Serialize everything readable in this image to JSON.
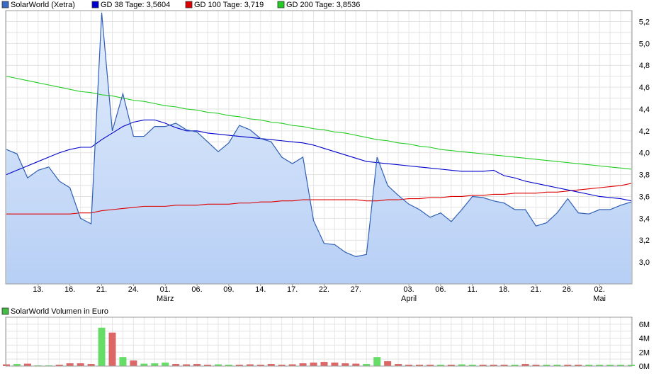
{
  "legend": [
    {
      "label": "SolarWorld (Xetra)",
      "color": "#3a6bc4"
    },
    {
      "label": "GD 38 Tage: 3,5604",
      "color": "#0000cc"
    },
    {
      "label": "GD 100 Tage: 3,719",
      "color": "#dd0000"
    },
    {
      "label": "GD 200 Tage: 3,8536",
      "color": "#22cc22"
    }
  ],
  "volume_legend": {
    "label": "SolarWorld Volumen in Euro",
    "color": "#44bb44"
  },
  "colors": {
    "price_line": "#2f5fb5",
    "price_fill_top": "#e4eefc",
    "price_fill_bottom": "#b7cff5",
    "gd38": "#0000cc",
    "gd100": "#dd0000",
    "gd200": "#22cc22",
    "volume_up": "#66dd66",
    "volume_down": "#dd6666",
    "grid": "#dddddd",
    "border": "#999999"
  },
  "chart_data": [
    {
      "type": "line",
      "title": "",
      "x_index_range": [
        0,
        59
      ],
      "ylim": [
        2.8,
        5.3
      ],
      "y_ticks": [
        {
          "v": 3.0,
          "label": "3,0"
        },
        {
          "v": 3.2,
          "label": "3,2"
        },
        {
          "v": 3.4,
          "label": "3,4"
        },
        {
          "v": 3.6,
          "label": "3,6"
        },
        {
          "v": 3.8,
          "label": "3,8"
        },
        {
          "v": 4.0,
          "label": "4,0"
        },
        {
          "v": 4.2,
          "label": "4,2"
        },
        {
          "v": 4.4,
          "label": "4,4"
        },
        {
          "v": 4.6,
          "label": "4,6"
        },
        {
          "v": 4.8,
          "label": "4,8"
        },
        {
          "v": 5.0,
          "label": "5,0"
        },
        {
          "v": 5.2,
          "label": "5,2"
        }
      ],
      "x_ticks": [
        {
          "i": 3,
          "label": "13."
        },
        {
          "i": 6,
          "label": "16."
        },
        {
          "i": 9,
          "label": "21."
        },
        {
          "i": 12,
          "label": "24."
        },
        {
          "i": 15,
          "label": "01.",
          "month": "März"
        },
        {
          "i": 18,
          "label": "06."
        },
        {
          "i": 21,
          "label": "09."
        },
        {
          "i": 24,
          "label": "14."
        },
        {
          "i": 27,
          "label": "17."
        },
        {
          "i": 30,
          "label": "22."
        },
        {
          "i": 33,
          "label": "27."
        },
        {
          "i": 38,
          "label": "03.",
          "month": "April"
        },
        {
          "i": 41,
          "label": "06."
        },
        {
          "i": 44,
          "label": "11."
        },
        {
          "i": 47,
          "label": "18."
        },
        {
          "i": 50,
          "label": "21."
        },
        {
          "i": 53,
          "label": "26."
        },
        {
          "i": 56,
          "label": "02.",
          "month": "Mai"
        }
      ],
      "series": [
        {
          "name": "SolarWorld (Xetra)",
          "values": [
            4.03,
            3.99,
            3.77,
            3.84,
            3.87,
            3.74,
            3.68,
            3.4,
            3.35,
            5.28,
            4.2,
            4.54,
            4.15,
            4.15,
            4.24,
            4.24,
            4.27,
            4.21,
            4.19,
            4.1,
            4.01,
            4.09,
            4.25,
            4.21,
            4.13,
            4.1,
            3.96,
            3.9,
            3.96,
            3.38,
            3.17,
            3.16,
            3.09,
            3.05,
            3.07,
            3.96,
            3.7,
            3.61,
            3.53,
            3.48,
            3.41,
            3.45,
            3.37,
            3.48,
            3.6,
            3.59,
            3.56,
            3.54,
            3.48,
            3.48,
            3.33,
            3.36,
            3.45,
            3.58,
            3.45,
            3.44,
            3.48,
            3.48,
            3.52,
            3.55
          ]
        },
        {
          "name": "GD 38 Tage: 3,5604",
          "values": [
            3.8,
            3.84,
            3.88,
            3.92,
            3.96,
            4.0,
            4.03,
            4.05,
            4.05,
            4.12,
            4.18,
            4.24,
            4.28,
            4.3,
            4.3,
            4.27,
            4.23,
            4.2,
            4.2,
            4.18,
            4.17,
            4.16,
            4.15,
            4.14,
            4.13,
            4.12,
            4.11,
            4.1,
            4.09,
            4.07,
            4.04,
            4.01,
            3.98,
            3.95,
            3.92,
            3.91,
            3.9,
            3.89,
            3.88,
            3.87,
            3.86,
            3.85,
            3.84,
            3.83,
            3.83,
            3.83,
            3.84,
            3.79,
            3.77,
            3.74,
            3.72,
            3.7,
            3.68,
            3.66,
            3.64,
            3.62,
            3.6,
            3.59,
            3.58,
            3.56
          ]
        },
        {
          "name": "GD 100 Tage: 3,719",
          "values": [
            3.44,
            3.44,
            3.44,
            3.44,
            3.44,
            3.44,
            3.44,
            3.45,
            3.45,
            3.47,
            3.48,
            3.49,
            3.5,
            3.51,
            3.51,
            3.51,
            3.52,
            3.52,
            3.52,
            3.53,
            3.53,
            3.53,
            3.54,
            3.54,
            3.55,
            3.55,
            3.56,
            3.56,
            3.57,
            3.57,
            3.57,
            3.57,
            3.57,
            3.57,
            3.56,
            3.56,
            3.57,
            3.57,
            3.58,
            3.58,
            3.59,
            3.59,
            3.6,
            3.6,
            3.61,
            3.61,
            3.62,
            3.62,
            3.63,
            3.63,
            3.63,
            3.64,
            3.64,
            3.65,
            3.66,
            3.67,
            3.68,
            3.69,
            3.7,
            3.72
          ]
        },
        {
          "name": "GD 200 Tage: 3,8536",
          "values": [
            4.7,
            4.68,
            4.66,
            4.64,
            4.62,
            4.6,
            4.58,
            4.56,
            4.55,
            4.53,
            4.52,
            4.5,
            4.48,
            4.47,
            4.45,
            4.43,
            4.42,
            4.4,
            4.39,
            4.37,
            4.36,
            4.34,
            4.33,
            4.31,
            4.3,
            4.28,
            4.27,
            4.25,
            4.24,
            4.22,
            4.21,
            4.19,
            4.18,
            4.16,
            4.14,
            4.12,
            4.11,
            4.09,
            4.08,
            4.06,
            4.05,
            4.03,
            4.02,
            4.01,
            4.0,
            3.99,
            3.98,
            3.97,
            3.96,
            3.95,
            3.94,
            3.93,
            3.92,
            3.91,
            3.9,
            3.89,
            3.88,
            3.87,
            3.86,
            3.85
          ]
        }
      ]
    },
    {
      "type": "bar",
      "title": "SolarWorld Volumen in Euro",
      "unit": "M",
      "ylim": [
        0,
        7
      ],
      "y_ticks": [
        {
          "v": 0,
          "label": "0M"
        },
        {
          "v": 2,
          "label": "2M"
        },
        {
          "v": 4,
          "label": "4M"
        },
        {
          "v": 6,
          "label": "6M"
        }
      ],
      "series": [
        {
          "name": "SolarWorld Volumen in Euro",
          "values": [
            0.25,
            0.3,
            0.35,
            0.1,
            0.1,
            0.2,
            0.4,
            0.4,
            0.3,
            5.5,
            4.8,
            1.3,
            0.8,
            0.35,
            0.4,
            0.5,
            0.3,
            0.25,
            0.3,
            0.2,
            0.25,
            0.2,
            0.2,
            0.25,
            0.2,
            0.3,
            0.2,
            0.25,
            0.4,
            0.5,
            0.6,
            0.5,
            0.4,
            0.35,
            0.3,
            1.3,
            0.7,
            0.3,
            0.2,
            0.2,
            0.2,
            0.2,
            0.2,
            0.25,
            0.2,
            0.2,
            0.2,
            0.2,
            0.2,
            0.3,
            0.2,
            0.2,
            0.2,
            0.2,
            0.2,
            0.2,
            0.2,
            0.2,
            0.2,
            0.2
          ],
          "direction": [
            "d",
            "u",
            "d",
            "u",
            "u",
            "d",
            "d",
            "d",
            "d",
            "u",
            "d",
            "u",
            "d",
            "u",
            "u",
            "u",
            "d",
            "d",
            "d",
            "d",
            "u",
            "u",
            "d",
            "d",
            "d",
            "d",
            "d",
            "d",
            "d",
            "d",
            "d",
            "d",
            "d",
            "d",
            "u",
            "u",
            "d",
            "d",
            "d",
            "d",
            "d",
            "u",
            "d",
            "u",
            "u",
            "d",
            "d",
            "d",
            "u",
            "d",
            "d",
            "u",
            "u",
            "d",
            "d",
            "u",
            "u",
            "u",
            "u",
            "u"
          ]
        }
      ]
    }
  ]
}
